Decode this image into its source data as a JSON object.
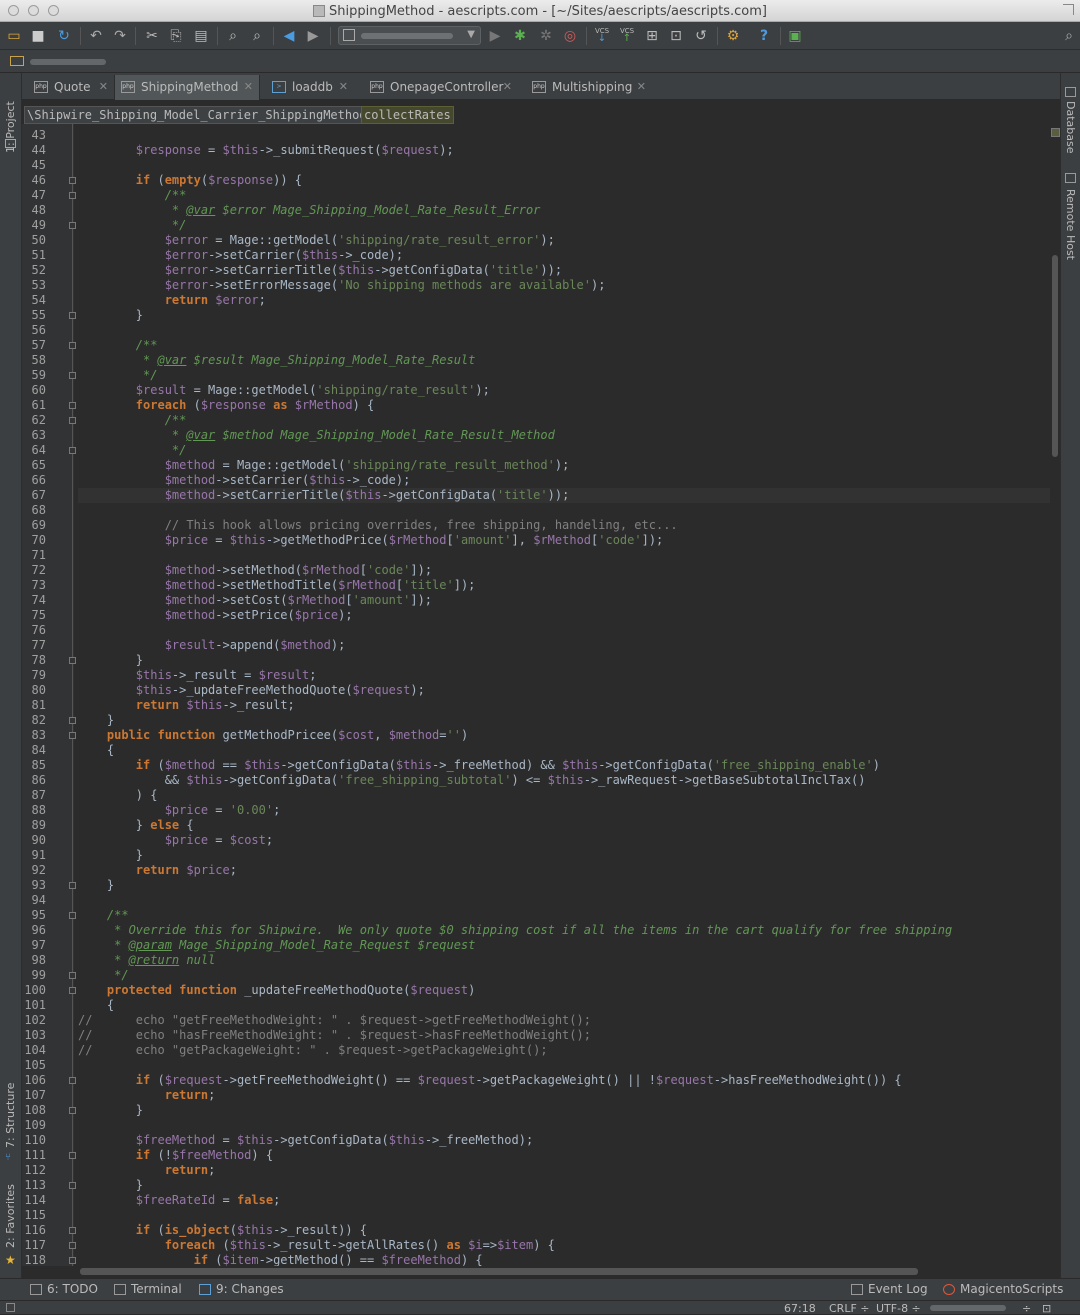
{
  "window": {
    "title": "ShippingMethod - aescripts.com - [~/Sites/aescripts/aescripts.com]"
  },
  "toolbar": {
    "run_config_value": "",
    "vcs_label_1": "VCS",
    "vcs_label_2": "VCS",
    "help_glyph": "?"
  },
  "tool_windows": {
    "left": [
      {
        "label": "1: Project"
      },
      {
        "label": "7: Structure"
      },
      {
        "label": "2: Favorites"
      }
    ],
    "right": [
      {
        "label": "Database"
      },
      {
        "label": "Remote Host"
      }
    ],
    "bottom_left": [
      {
        "label": "6: TODO"
      },
      {
        "label": "Terminal"
      },
      {
        "label": "9: Changes"
      }
    ],
    "bottom_right": [
      {
        "label": "Event Log"
      },
      {
        "label": "MagicentoScripts"
      }
    ]
  },
  "tabs": [
    {
      "label": "Quote",
      "icon": "php-file-icon",
      "active": false
    },
    {
      "label": "ShippingMethod",
      "icon": "php-file-icon",
      "active": true
    },
    {
      "label": "loaddb",
      "icon": "shell-file-icon",
      "active": false
    },
    {
      "label": "OnepageController",
      "icon": "php-file-icon",
      "active": false
    },
    {
      "label": "Multishipping",
      "icon": "php-file-icon",
      "active": false
    }
  ],
  "breadcrumbs": {
    "class": "\\Shipwire_Shipping_Model_Carrier_ShippingMethod",
    "method": "collectRates"
  },
  "editor": {
    "lines": [
      {
        "n": "43",
        "t": ""
      },
      {
        "n": "44",
        "t": "        $response = $this->_submitRequest($request);"
      },
      {
        "n": "45",
        "t": ""
      },
      {
        "n": "46",
        "t": "        if (empty($response)) {"
      },
      {
        "n": "47",
        "t": "            /**"
      },
      {
        "n": "48",
        "t": "             * @var $error Mage_Shipping_Model_Rate_Result_Error"
      },
      {
        "n": "49",
        "t": "             */"
      },
      {
        "n": "50",
        "t": "            $error = Mage::getModel('shipping/rate_result_error');"
      },
      {
        "n": "51",
        "t": "            $error->setCarrier($this->_code);"
      },
      {
        "n": "52",
        "t": "            $error->setCarrierTitle($this->getConfigData('title'));"
      },
      {
        "n": "53",
        "t": "            $error->setErrorMessage('No shipping methods are available');"
      },
      {
        "n": "54",
        "t": "            return $error;"
      },
      {
        "n": "55",
        "t": "        }"
      },
      {
        "n": "56",
        "t": ""
      },
      {
        "n": "57",
        "t": "        /**"
      },
      {
        "n": "58",
        "t": "         * @var $result Mage_Shipping_Model_Rate_Result"
      },
      {
        "n": "59",
        "t": "         */"
      },
      {
        "n": "60",
        "t": "        $result = Mage::getModel('shipping/rate_result');"
      },
      {
        "n": "61",
        "t": "        foreach ($response as $rMethod) {"
      },
      {
        "n": "62",
        "t": "            /**"
      },
      {
        "n": "63",
        "t": "             * @var $method Mage_Shipping_Model_Rate_Result_Method"
      },
      {
        "n": "64",
        "t": "             */"
      },
      {
        "n": "65",
        "t": "            $method = Mage::getModel('shipping/rate_result_method');"
      },
      {
        "n": "66",
        "t": "            $method->setCarrier($this->_code);"
      },
      {
        "n": "67",
        "t": "            $method->setCarrierTitle($this->getConfigData('title'));"
      },
      {
        "n": "68",
        "t": ""
      },
      {
        "n": "69",
        "t": "            // This hook allows pricing overrides, free shipping, handeling, etc..."
      },
      {
        "n": "70",
        "t": "            $price = $this->getMethodPrice($rMethod['amount'], $rMethod['code']);"
      },
      {
        "n": "71",
        "t": ""
      },
      {
        "n": "72",
        "t": "            $method->setMethod($rMethod['code']);"
      },
      {
        "n": "73",
        "t": "            $method->setMethodTitle($rMethod['title']);"
      },
      {
        "n": "74",
        "t": "            $method->setCost($rMethod['amount']);"
      },
      {
        "n": "75",
        "t": "            $method->setPrice($price);"
      },
      {
        "n": "76",
        "t": ""
      },
      {
        "n": "77",
        "t": "            $result->append($method);"
      },
      {
        "n": "78",
        "t": "        }"
      },
      {
        "n": "79",
        "t": "        $this->_result = $result;"
      },
      {
        "n": "80",
        "t": "        $this->_updateFreeMethodQuote($request);"
      },
      {
        "n": "81",
        "t": "        return $this->_result;"
      },
      {
        "n": "82",
        "t": "    }"
      },
      {
        "n": "83",
        "t": "    public function getMethodPricee($cost, $method='')"
      },
      {
        "n": "84",
        "t": "    {"
      },
      {
        "n": "85",
        "t": "        if ($method == $this->getConfigData($this->_freeMethod) && $this->getConfigData('free_shipping_enable')"
      },
      {
        "n": "86",
        "t": "            && $this->getConfigData('free_shipping_subtotal') <= $this->_rawRequest->getBaseSubtotalInclTax()"
      },
      {
        "n": "87",
        "t": "        ) {"
      },
      {
        "n": "88",
        "t": "            $price = '0.00';"
      },
      {
        "n": "89",
        "t": "        } else {"
      },
      {
        "n": "90",
        "t": "            $price = $cost;"
      },
      {
        "n": "91",
        "t": "        }"
      },
      {
        "n": "92",
        "t": "        return $price;"
      },
      {
        "n": "93",
        "t": "    }"
      },
      {
        "n": "94",
        "t": ""
      },
      {
        "n": "95",
        "t": "    /**"
      },
      {
        "n": "96",
        "t": "     * Override this for Shipwire.  We only quote $0 shipping cost if all the items in the cart qualify for free shipping"
      },
      {
        "n": "97",
        "t": "     * @param Mage_Shipping_Model_Rate_Request $request"
      },
      {
        "n": "98",
        "t": "     * @return null"
      },
      {
        "n": "99",
        "t": "     */"
      },
      {
        "n": "100",
        "t": "    protected function _updateFreeMethodQuote($request)"
      },
      {
        "n": "101",
        "t": "    {"
      },
      {
        "n": "102",
        "t": "//      echo \"getFreeMethodWeight: \" . $request->getFreeMethodWeight();"
      },
      {
        "n": "103",
        "t": "//      echo \"hasFreeMethodWeight: \" . $request->hasFreeMethodWeight();"
      },
      {
        "n": "104",
        "t": "//      echo \"getPackageWeight: \" . $request->getPackageWeight();"
      },
      {
        "n": "105",
        "t": ""
      },
      {
        "n": "106",
        "t": "        if ($request->getFreeMethodWeight() == $request->getPackageWeight() || !$request->hasFreeMethodWeight()) {"
      },
      {
        "n": "107",
        "t": "            return;"
      },
      {
        "n": "108",
        "t": "        }"
      },
      {
        "n": "109",
        "t": ""
      },
      {
        "n": "110",
        "t": "        $freeMethod = $this->getConfigData($this->_freeMethod);"
      },
      {
        "n": "111",
        "t": "        if (!$freeMethod) {"
      },
      {
        "n": "112",
        "t": "            return;"
      },
      {
        "n": "113",
        "t": "        }"
      },
      {
        "n": "114",
        "t": "        $freeRateId = false;"
      },
      {
        "n": "115",
        "t": ""
      },
      {
        "n": "116",
        "t": "        if (is_object($this->_result)) {"
      },
      {
        "n": "117",
        "t": "            foreach ($this->_result->getAllRates() as $i=>$item) {"
      },
      {
        "n": "118",
        "t": "                if ($item->getMethod() == $freeMethod) {"
      }
    ],
    "caret_line": "67"
  },
  "status": {
    "position": "67:18",
    "line_separator": "CRLF ÷",
    "encoding": "UTF-8 ÷"
  }
}
